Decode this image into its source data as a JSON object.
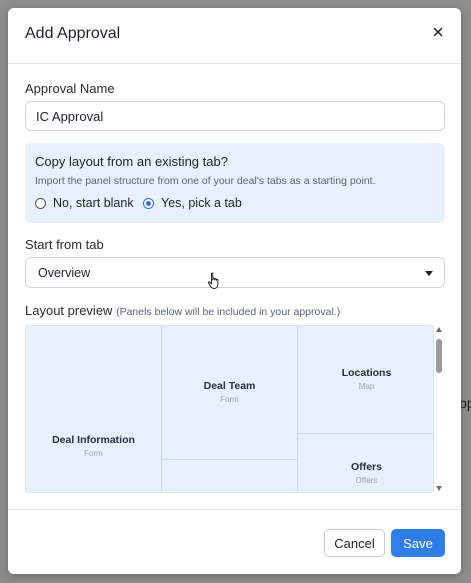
{
  "background": {
    "fragment_text": "pp"
  },
  "modal": {
    "title": "Add Approval",
    "close_icon": "close-icon"
  },
  "approval_name": {
    "label": "Approval Name",
    "value": "IC Approval"
  },
  "copy_layout": {
    "title": "Copy layout from an existing tab?",
    "description": "Import the panel structure from one of your deal's tabs as a starting point.",
    "options": [
      {
        "label": "No, start blank",
        "selected": false
      },
      {
        "label": "Yes, pick a tab",
        "selected": true
      }
    ]
  },
  "start_from_tab": {
    "label": "Start from tab",
    "selected": "Overview"
  },
  "layout_preview": {
    "label": "Layout preview",
    "hint": "(Panels below will be included in your approval.)",
    "panels": [
      {
        "title": "Deal Information",
        "subtitle": "Form"
      },
      {
        "title": "Deal Team",
        "subtitle": "Form"
      },
      {
        "title": "Locations",
        "subtitle": "Map"
      },
      {
        "title": "Offers",
        "subtitle": "Offers"
      }
    ]
  },
  "footer": {
    "cancel_label": "Cancel",
    "save_label": "Save"
  },
  "colors": {
    "accent": "#2f7ee8",
    "panel_bg": "#e7f1fc",
    "preview_bg": "#e6f1fd"
  }
}
